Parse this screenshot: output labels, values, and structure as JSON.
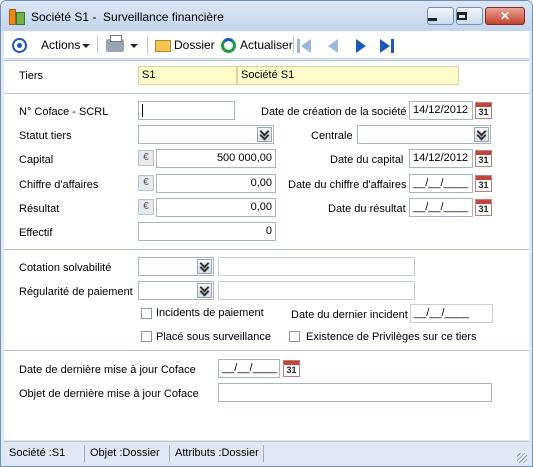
{
  "window": {
    "title": "Société S1 -  Surveillance financière"
  },
  "toolbar": {
    "actions_label": "Actions",
    "dossier_label": "Dossier",
    "actualiser_label": "Actualiser"
  },
  "form": {
    "tiers": {
      "label": "Tiers",
      "code": "S1",
      "name": "Société S1"
    },
    "coface": {
      "label": "N° Coface - SCRL",
      "value": ""
    },
    "date_creation": {
      "label": "Date de création de la société",
      "value": "14/12/2012"
    },
    "statut_tiers": {
      "label": "Statut tiers",
      "value": ""
    },
    "centrale": {
      "label": "Centrale",
      "value": ""
    },
    "capital": {
      "label": "Capital",
      "value": "500 000,00"
    },
    "date_capital": {
      "label": "Date du capital",
      "value": "14/12/2012"
    },
    "chiffre_affaires": {
      "label": "Chiffre d'affaires",
      "value": "0,00"
    },
    "date_chiffre_affaires": {
      "label": "Date du chiffre d'affaires",
      "value": "__/__/____"
    },
    "resultat": {
      "label": "Résultat",
      "value": "0,00"
    },
    "date_resultat": {
      "label": "Date du résultat",
      "value": "__/__/____"
    },
    "effectif": {
      "label": "Effectif",
      "value": "0"
    },
    "cotation": {
      "label": "Cotation solvabilité",
      "value": "",
      "description": ""
    },
    "regularite": {
      "label": "Régularité de paiement",
      "value": "",
      "description": ""
    },
    "incidents": {
      "label": "Incidents de paiement",
      "checked": false
    },
    "date_dernier_incident": {
      "label": "Date du dernier incident",
      "value": "__/__/____"
    },
    "surveillance": {
      "label": "Placé sous surveillance",
      "checked": false
    },
    "privileges": {
      "label": "Existence de Privilèges sur ce tiers",
      "checked": false
    },
    "date_maj_coface": {
      "label": "Date de dernière mise à jour Coface",
      "value": "__/__/____"
    },
    "objet_maj_coface": {
      "label": "Objet de dernière mise à jour Coface",
      "value": ""
    }
  },
  "icons": {
    "currency": "€",
    "calendar": "31",
    "close": "✕"
  },
  "statusbar": {
    "societe": "Société :S1",
    "objet": "Objet :Dossier",
    "attributs": "Attributs :Dossier"
  },
  "colors": {
    "accent": "#1c58b8",
    "highlight_field": "#fdfbc8"
  }
}
